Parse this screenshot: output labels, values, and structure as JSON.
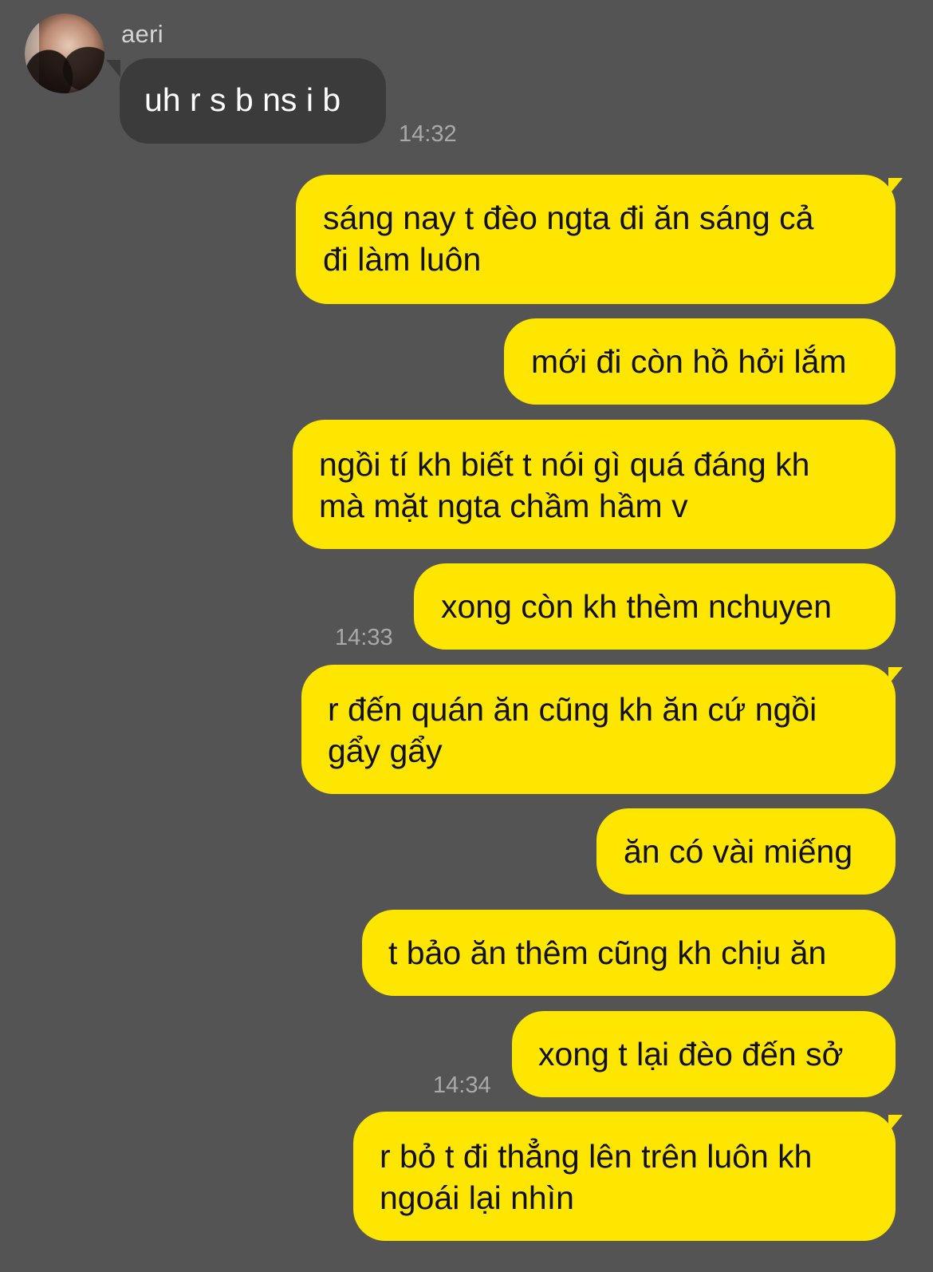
{
  "chat": {
    "contact_name": "aeri",
    "avatar_icon": "profile-photo-avatar",
    "incoming": [
      {
        "text": "uh r s b ns i b",
        "time": "14:32"
      }
    ],
    "outgoing": [
      {
        "text": "sáng nay t đèo ngta đi ăn sáng cả\nđi làm luôn"
      },
      {
        "text": "mới đi còn hồ hởi lắm"
      },
      {
        "text": "ngồi tí kh biết t nói gì quá đáng kh\nmà mặt ngta chầm hầm v"
      },
      {
        "text": "xong còn kh thèm nchuyen",
        "time": "14:33"
      },
      {
        "text": "r đến quán ăn cũng kh ăn cứ ngồi\ngẩy gẩy"
      },
      {
        "text": "ăn có vài miếng"
      },
      {
        "text": "t bảo ăn thêm cũng kh chịu ăn"
      },
      {
        "text": "xong t lại đèo đến sở",
        "time": "14:34"
      },
      {
        "text": "r bỏ t đi thẳng lên trên luôn kh\nngoái lại nhìn"
      }
    ]
  },
  "colors": {
    "background": "#545454",
    "incoming_bubble": "#3b3b3b",
    "outgoing_bubble": "#ffe600",
    "timestamp": "#a9a9a9"
  }
}
